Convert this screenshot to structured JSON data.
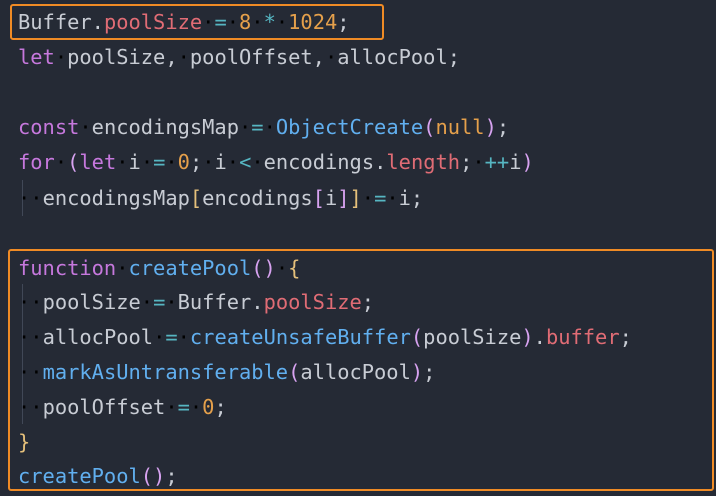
{
  "editor": {
    "colors": {
      "background": "#252a35",
      "highlight_border": "#f08b25"
    },
    "lines": [
      {
        "tokens": [
          {
            "t": "Buffer",
            "c": "default"
          },
          {
            "t": ".",
            "c": "default"
          },
          {
            "t": "poolSize",
            "c": "prop"
          },
          {
            "t": " ",
            "c": "ws"
          },
          {
            "t": "=",
            "c": "op"
          },
          {
            "t": " ",
            "c": "ws"
          },
          {
            "t": "8",
            "c": "num"
          },
          {
            "t": " ",
            "c": "ws"
          },
          {
            "t": "*",
            "c": "op"
          },
          {
            "t": " ",
            "c": "ws"
          },
          {
            "t": "1024",
            "c": "num"
          },
          {
            "t": ";",
            "c": "default"
          }
        ]
      },
      {
        "tokens": [
          {
            "t": "let",
            "c": "kw"
          },
          {
            "t": " ",
            "c": "ws"
          },
          {
            "t": "poolSize,",
            "c": "default"
          },
          {
            "t": " ",
            "c": "ws"
          },
          {
            "t": "poolOffset,",
            "c": "default"
          },
          {
            "t": " ",
            "c": "ws"
          },
          {
            "t": "allocPool;",
            "c": "default"
          }
        ]
      },
      {
        "tokens": []
      },
      {
        "tokens": [
          {
            "t": "const",
            "c": "kw"
          },
          {
            "t": " ",
            "c": "ws"
          },
          {
            "t": "encodingsMap",
            "c": "default"
          },
          {
            "t": " ",
            "c": "ws"
          },
          {
            "t": "=",
            "c": "op"
          },
          {
            "t": " ",
            "c": "ws"
          },
          {
            "t": "ObjectCreate",
            "c": "fn"
          },
          {
            "t": "(",
            "c": "paren"
          },
          {
            "t": "null",
            "c": "null"
          },
          {
            "t": ")",
            "c": "paren"
          },
          {
            "t": ";",
            "c": "default"
          }
        ]
      },
      {
        "tokens": [
          {
            "t": "for",
            "c": "kw"
          },
          {
            "t": " ",
            "c": "ws"
          },
          {
            "t": "(",
            "c": "paren"
          },
          {
            "t": "let",
            "c": "kw"
          },
          {
            "t": " ",
            "c": "ws"
          },
          {
            "t": "i",
            "c": "default"
          },
          {
            "t": " ",
            "c": "ws"
          },
          {
            "t": "=",
            "c": "op"
          },
          {
            "t": " ",
            "c": "ws"
          },
          {
            "t": "0",
            "c": "num"
          },
          {
            "t": ";",
            "c": "default"
          },
          {
            "t": " ",
            "c": "ws"
          },
          {
            "t": "i",
            "c": "default"
          },
          {
            "t": " ",
            "c": "ws"
          },
          {
            "t": "<",
            "c": "op"
          },
          {
            "t": " ",
            "c": "ws"
          },
          {
            "t": "encodings",
            "c": "default"
          },
          {
            "t": ".",
            "c": "default"
          },
          {
            "t": "length",
            "c": "prop"
          },
          {
            "t": ";",
            "c": "default"
          },
          {
            "t": " ",
            "c": "ws"
          },
          {
            "t": "++",
            "c": "op"
          },
          {
            "t": "i",
            "c": "default"
          },
          {
            "t": ")",
            "c": "paren"
          }
        ]
      },
      {
        "tokens": [
          {
            "t": "  ",
            "c": "ws"
          },
          {
            "t": "encodingsMap",
            "c": "default"
          },
          {
            "t": "[",
            "c": "brace"
          },
          {
            "t": "encodings",
            "c": "default"
          },
          {
            "t": "[",
            "c": "paren"
          },
          {
            "t": "i",
            "c": "default"
          },
          {
            "t": "]",
            "c": "paren"
          },
          {
            "t": "]",
            "c": "brace"
          },
          {
            "t": " ",
            "c": "ws"
          },
          {
            "t": "=",
            "c": "op"
          },
          {
            "t": " ",
            "c": "ws"
          },
          {
            "t": "i;",
            "c": "default"
          }
        ]
      },
      {
        "tokens": []
      },
      {
        "tokens": [
          {
            "t": "function",
            "c": "kw"
          },
          {
            "t": " ",
            "c": "ws"
          },
          {
            "t": "createPool",
            "c": "fn"
          },
          {
            "t": "()",
            "c": "paren"
          },
          {
            "t": " ",
            "c": "ws"
          },
          {
            "t": "{",
            "c": "brace"
          }
        ]
      },
      {
        "tokens": [
          {
            "t": "  ",
            "c": "ws"
          },
          {
            "t": "poolSize",
            "c": "default"
          },
          {
            "t": " ",
            "c": "ws"
          },
          {
            "t": "=",
            "c": "op"
          },
          {
            "t": " ",
            "c": "ws"
          },
          {
            "t": "Buffer",
            "c": "default"
          },
          {
            "t": ".",
            "c": "default"
          },
          {
            "t": "poolSize",
            "c": "prop"
          },
          {
            "t": ";",
            "c": "default"
          }
        ]
      },
      {
        "tokens": [
          {
            "t": "  ",
            "c": "ws"
          },
          {
            "t": "allocPool",
            "c": "default"
          },
          {
            "t": " ",
            "c": "ws"
          },
          {
            "t": "=",
            "c": "op"
          },
          {
            "t": " ",
            "c": "ws"
          },
          {
            "t": "createUnsafeBuffer",
            "c": "fn"
          },
          {
            "t": "(",
            "c": "paren"
          },
          {
            "t": "poolSize",
            "c": "default"
          },
          {
            "t": ")",
            "c": "paren"
          },
          {
            "t": ".",
            "c": "default"
          },
          {
            "t": "buffer",
            "c": "prop"
          },
          {
            "t": ";",
            "c": "default"
          }
        ]
      },
      {
        "tokens": [
          {
            "t": "  ",
            "c": "ws"
          },
          {
            "t": "markAsUntransferable",
            "c": "fn"
          },
          {
            "t": "(",
            "c": "paren"
          },
          {
            "t": "allocPool",
            "c": "default"
          },
          {
            "t": ")",
            "c": "paren"
          },
          {
            "t": ";",
            "c": "default"
          }
        ]
      },
      {
        "tokens": [
          {
            "t": "  ",
            "c": "ws"
          },
          {
            "t": "poolOffset",
            "c": "default"
          },
          {
            "t": " ",
            "c": "ws"
          },
          {
            "t": "=",
            "c": "op"
          },
          {
            "t": " ",
            "c": "ws"
          },
          {
            "t": "0",
            "c": "num"
          },
          {
            "t": ";",
            "c": "default"
          }
        ]
      },
      {
        "tokens": [
          {
            "t": "}",
            "c": "brace"
          }
        ]
      },
      {
        "tokens": [
          {
            "t": "createPool",
            "c": "fn"
          },
          {
            "t": "()",
            "c": "paren"
          },
          {
            "t": ";",
            "c": "default"
          }
        ]
      }
    ]
  }
}
